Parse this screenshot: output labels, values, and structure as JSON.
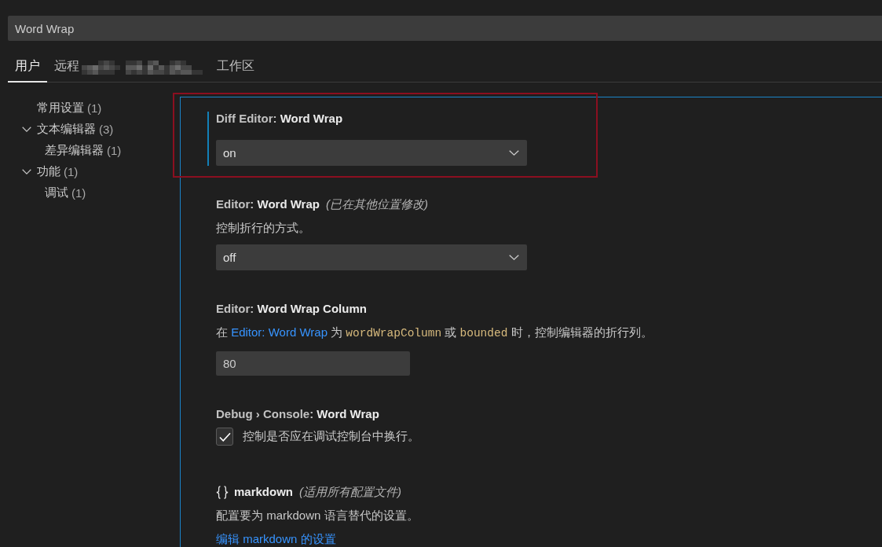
{
  "search": {
    "value": "Word Wrap"
  },
  "tabs": [
    {
      "label": "用户",
      "selected": true,
      "redacted": false
    },
    {
      "label": "远程",
      "selected": false,
      "redacted": true
    },
    {
      "label": "工作区",
      "selected": false,
      "redacted": false
    }
  ],
  "toc": [
    {
      "label": "常用设置",
      "count": "(1)",
      "selected": false
    },
    {
      "label": "文本编辑器",
      "count": "(3)",
      "selected": false,
      "expanded": true,
      "children": [
        {
          "label": "差异编辑器",
          "count": "(1)",
          "selected": false
        }
      ]
    },
    {
      "label": "功能",
      "count": "(1)",
      "selected": false,
      "expanded": true,
      "children": [
        {
          "label": "调试",
          "count": "(1)",
          "selected": false
        }
      ]
    }
  ],
  "settings": [
    {
      "kind": "select",
      "focused": true,
      "highlighted": true,
      "category": "Diff Editor:",
      "key": "Word Wrap",
      "value": "on"
    },
    {
      "kind": "select",
      "focused": false,
      "highlighted": false,
      "category": "Editor:",
      "key": "Word Wrap",
      "note": "(已在其他位置修改)",
      "description": [
        {
          "kind": "text",
          "text": "控制折行的方式。"
        }
      ],
      "value": "off"
    },
    {
      "kind": "number",
      "focused": false,
      "highlighted": false,
      "category": "Editor:",
      "key": "Word Wrap Column",
      "description": [
        {
          "kind": "text",
          "text": "在 "
        },
        {
          "kind": "link",
          "text": "Editor: Word Wrap"
        },
        {
          "kind": "text",
          "text": " 为 "
        },
        {
          "kind": "code",
          "text": "wordWrapColumn"
        },
        {
          "kind": "text",
          "text": " 或 "
        },
        {
          "kind": "code",
          "text": "bounded"
        },
        {
          "kind": "text",
          "text": " 时，控制编辑器的折行列。"
        }
      ],
      "value": "80"
    },
    {
      "kind": "checkbox",
      "focused": false,
      "highlighted": false,
      "category": "Debug › Console:",
      "key": "Word Wrap",
      "checked": true,
      "label": "控制是否应在调试控制台中换行。"
    },
    {
      "kind": "language",
      "focused": false,
      "highlighted": false,
      "key": "markdown",
      "note": "(适用所有配置文件)",
      "description": [
        {
          "kind": "text",
          "text": "配置要为 markdown 语言替代的设置。"
        }
      ],
      "link": "编辑 markdown 的设置"
    }
  ]
}
